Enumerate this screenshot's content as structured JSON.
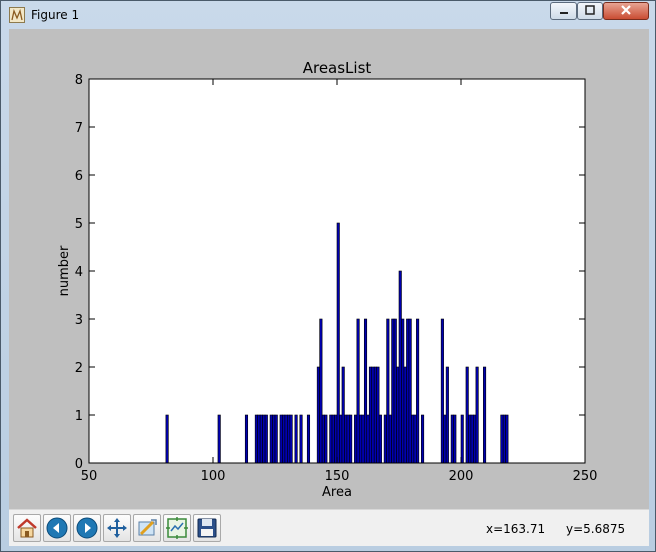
{
  "window": {
    "title": "Figure 1"
  },
  "colors": {
    "bar_fill": "#0000b0",
    "bar_edge": "#000000",
    "figure_bg": "#bfbfbf",
    "axes_bg": "#ffffff"
  },
  "chart_data": {
    "type": "bar",
    "title": "AreasList",
    "xlabel": "Area",
    "ylabel": "number",
    "xlim": [
      50,
      250
    ],
    "ylim": [
      0,
      8
    ],
    "xticks": [
      "50",
      "100",
      "150",
      "200",
      "250"
    ],
    "yticks": [
      "0",
      "1",
      "2",
      "3",
      "4",
      "5",
      "6",
      "7",
      "8"
    ],
    "bin_width": 1,
    "grid": false,
    "x": [
      81,
      102,
      113,
      117,
      118,
      119,
      120,
      121,
      123,
      124,
      125,
      127,
      128,
      129,
      130,
      131,
      133,
      135,
      138,
      142,
      143,
      144,
      145,
      147,
      148,
      149,
      150,
      151,
      152,
      153,
      154,
      155,
      157,
      158,
      159,
      160,
      161,
      162,
      163,
      164,
      165,
      166,
      167,
      169,
      170,
      171,
      172,
      173,
      174,
      175,
      176,
      177,
      178,
      179,
      180,
      181,
      182,
      184,
      192,
      193,
      194,
      196,
      197,
      200,
      202,
      203,
      204,
      205,
      206,
      209,
      216,
      217,
      218
    ],
    "values": [
      1,
      1,
      1,
      1,
      1,
      1,
      1,
      1,
      1,
      1,
      1,
      1,
      1,
      1,
      1,
      1,
      1,
      1,
      1,
      2,
      3,
      1,
      1,
      1,
      1,
      1,
      5,
      1,
      2,
      1,
      1,
      1,
      1,
      3,
      1,
      1,
      3,
      1,
      2,
      2,
      2,
      2,
      1,
      1,
      3,
      1,
      3,
      3,
      2,
      4,
      3,
      2,
      3,
      3,
      1,
      1,
      3,
      1,
      3,
      1,
      2,
      1,
      1,
      1,
      2,
      1,
      1,
      1,
      2,
      2,
      1,
      1,
      1
    ]
  },
  "toolbar": {
    "buttons": [
      {
        "name": "home-button",
        "icon": "home-icon"
      },
      {
        "name": "back-button",
        "icon": "back-arrow-icon"
      },
      {
        "name": "forward-button",
        "icon": "forward-arrow-icon"
      },
      {
        "name": "pan-button",
        "icon": "move-icon"
      },
      {
        "name": "zoom-button",
        "icon": "zoom-rect-icon"
      },
      {
        "name": "subplots-button",
        "icon": "subplots-icon"
      },
      {
        "name": "save-button",
        "icon": "floppy-icon"
      }
    ],
    "coord_x": "x=163.71",
    "coord_y": "y=5.6875"
  }
}
